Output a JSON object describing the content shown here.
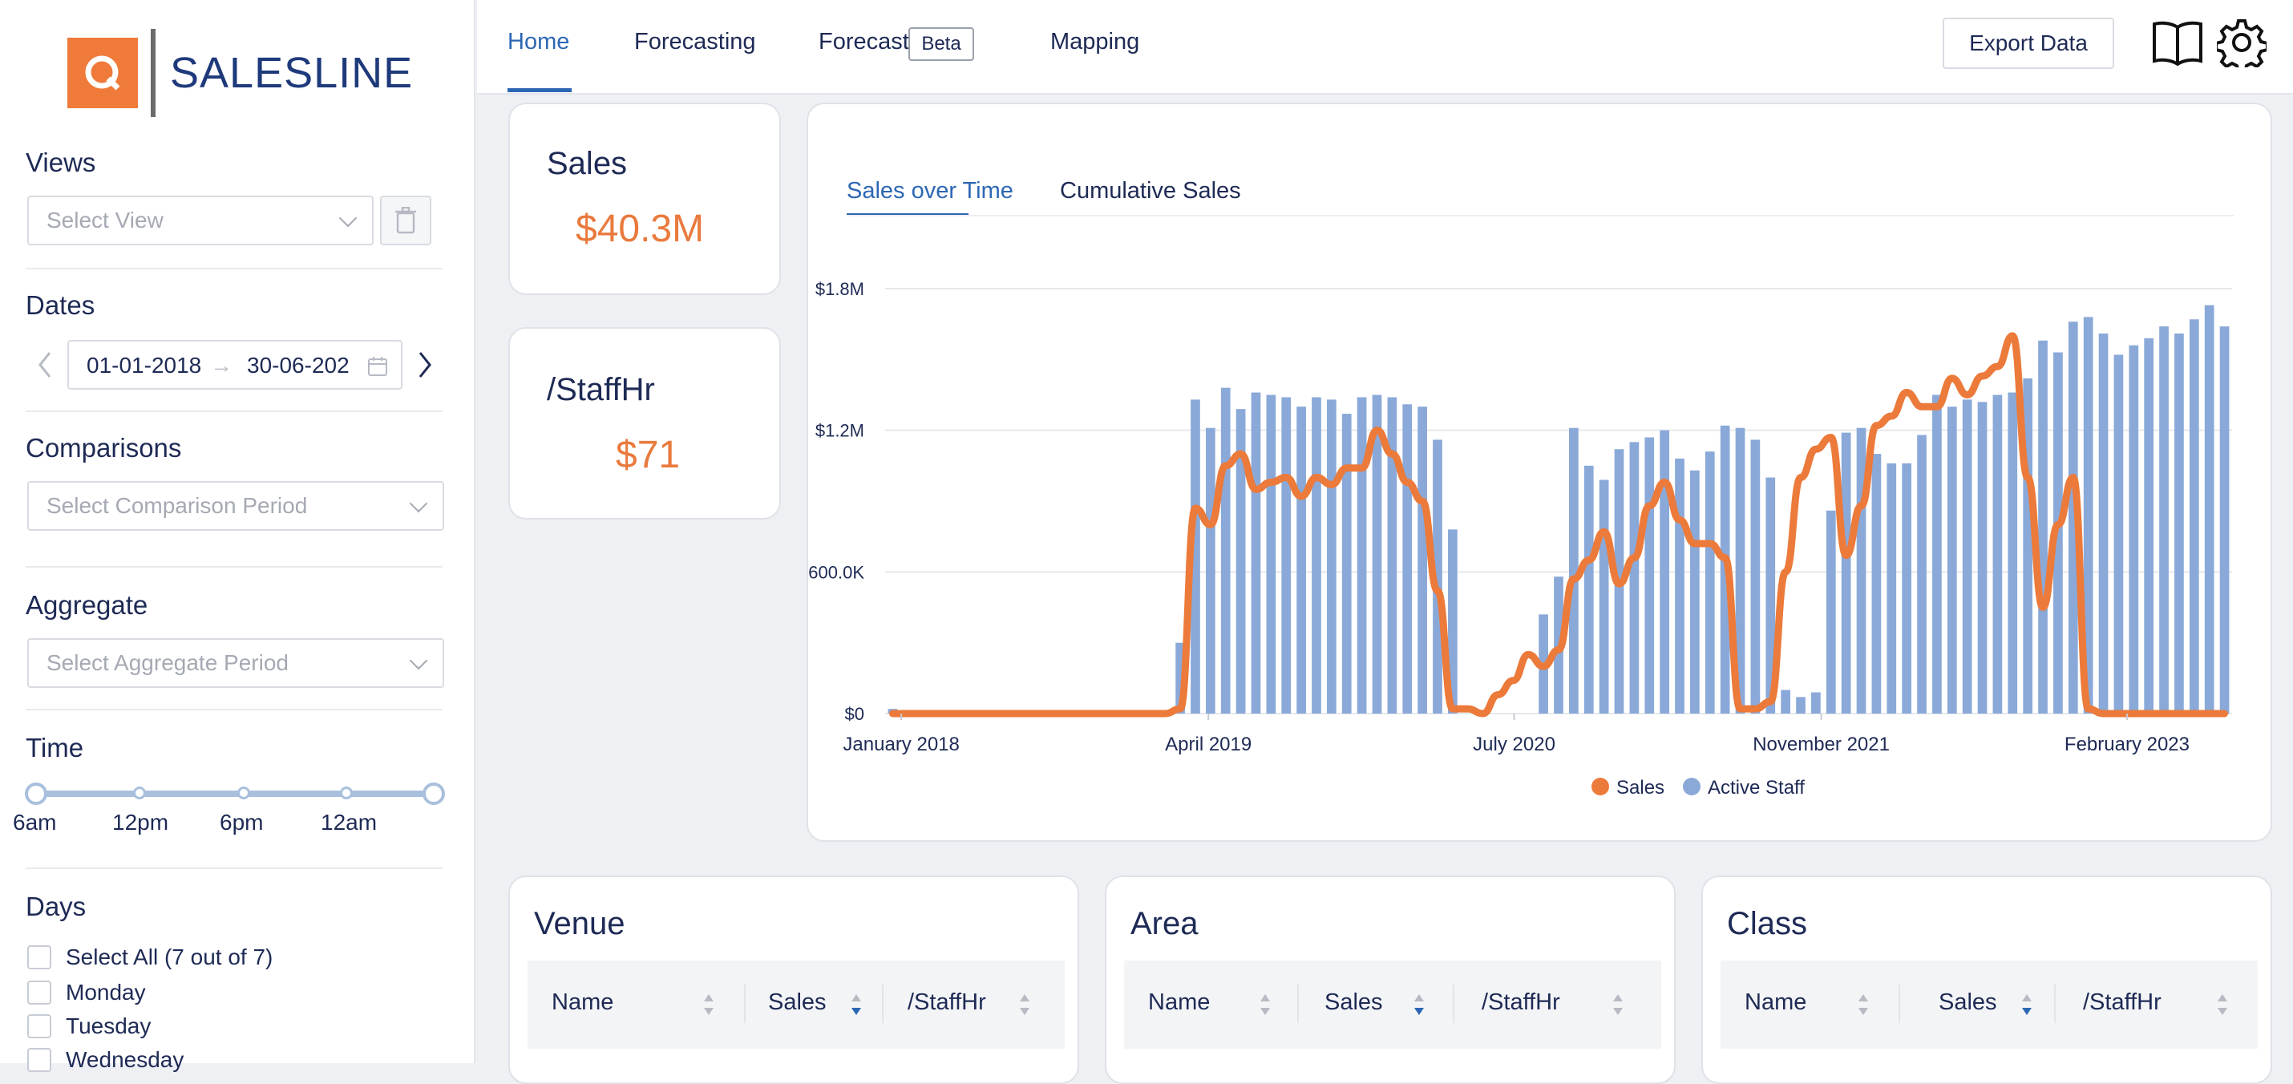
{
  "brand": {
    "name": "SALESLINE",
    "logo_letter": "Q",
    "accent": "#ef7a39",
    "primary": "#2d67b3"
  },
  "nav": {
    "tabs": [
      {
        "label": "Home",
        "active": true
      },
      {
        "label": "Forecasting"
      },
      {
        "label": "Forecast",
        "badge": "Beta"
      },
      {
        "label": "Mapping"
      }
    ],
    "export_label": "Export Data",
    "icons": [
      "book-icon",
      "gear-icon"
    ]
  },
  "sidebar": {
    "views": {
      "label": "Views",
      "placeholder": "Select View"
    },
    "dates": {
      "label": "Dates",
      "start": "01-01-2018",
      "end": "30-06-202"
    },
    "comparisons": {
      "label": "Comparisons",
      "placeholder": "Select Comparison Period"
    },
    "aggregate": {
      "label": "Aggregate",
      "placeholder": "Select Aggregate Period"
    },
    "time": {
      "label": "Time",
      "ticks": [
        "6am",
        "12pm",
        "6pm",
        "12am"
      ]
    },
    "days": {
      "label": "Days",
      "options": [
        "Select All (7 out of 7)",
        "Monday",
        "Tuesday",
        "Wednesday"
      ]
    }
  },
  "kpis": {
    "sales": {
      "title": "Sales",
      "value": "$40.3M"
    },
    "staffhr": {
      "title": "/StaffHr",
      "value": "$71"
    }
  },
  "chart_tabs": [
    {
      "label": "Sales over Time",
      "active": true
    },
    {
      "label": "Cumulative Sales"
    }
  ],
  "chart_data": {
    "type": "bar",
    "ylim": [
      0,
      1800000
    ],
    "yticks": [
      "$0",
      "$600.0K",
      "$1.2M",
      "$1.8M"
    ],
    "xticks": [
      "January 2018",
      "April 2019",
      "July 2020",
      "November 2021",
      "February 2023"
    ],
    "colors": {
      "sales": "#ec7a3a",
      "staff": "#8aa9d8"
    },
    "series": [
      {
        "name": "Active Staff",
        "type": "bar",
        "values": [
          0.02,
          0,
          0,
          0,
          0,
          0,
          0,
          0,
          0,
          0,
          0,
          0,
          0,
          0,
          0,
          0,
          0,
          0,
          0,
          0.3,
          1.33,
          1.21,
          1.38,
          1.29,
          1.36,
          1.35,
          1.34,
          1.3,
          1.34,
          1.33,
          1.27,
          1.34,
          1.35,
          1.34,
          1.31,
          1.3,
          1.16,
          0.78,
          0,
          0,
          0,
          0,
          0,
          0.42,
          0.58,
          1.21,
          1.05,
          0.99,
          1.12,
          1.15,
          1.17,
          1.2,
          1.08,
          1.03,
          1.11,
          1.22,
          1.21,
          1.16,
          1.0,
          0.1,
          0.07,
          0.09,
          0.86,
          1.19,
          1.21,
          1.1,
          1.06,
          1.06,
          1.18,
          1.35,
          1.3,
          1.33,
          1.32,
          1.35,
          1.36,
          1.42,
          1.58,
          1.53,
          1.66,
          1.68,
          1.61,
          1.52,
          1.56,
          1.59,
          1.64,
          1.61,
          1.67,
          1.73,
          1.64
        ]
      },
      {
        "name": "Sales",
        "type": "line",
        "values": [
          0,
          0,
          0,
          0,
          0,
          0,
          0,
          0,
          0,
          0,
          0,
          0,
          0,
          0,
          0,
          0,
          0,
          0,
          0,
          0.02,
          0.87,
          0.8,
          1.05,
          1.1,
          0.95,
          0.98,
          1.0,
          0.92,
          1.0,
          0.97,
          1.04,
          1.04,
          1.2,
          1.1,
          0.98,
          0.9,
          0.52,
          0.02,
          0.02,
          0.0,
          0.08,
          0.14,
          0.25,
          0.2,
          0.27,
          0.57,
          0.65,
          0.77,
          0.55,
          0.66,
          0.88,
          0.98,
          0.82,
          0.72,
          0.72,
          0.66,
          0.02,
          0.02,
          0.05,
          0.6,
          1.0,
          1.12,
          1.17,
          0.67,
          0.88,
          1.22,
          1.26,
          1.36,
          1.3,
          1.3,
          1.42,
          1.35,
          1.43,
          1.47,
          1.6,
          1.0,
          0.45,
          0.8,
          1.0,
          0.02,
          0.0,
          0.0,
          0.0,
          0.0,
          0.0,
          0.0,
          0.0,
          0.0,
          0.0
        ],
        "scale": 1200000
      }
    ],
    "legend": [
      "Sales",
      "Active Staff"
    ],
    "legend_position": "bottom"
  },
  "tables": [
    {
      "title": "Venue",
      "columns": [
        "Name",
        "Sales",
        "/StaffHr"
      ]
    },
    {
      "title": "Area",
      "columns": [
        "Name",
        "Sales",
        "/StaffHr"
      ]
    },
    {
      "title": "Class",
      "columns": [
        "Name",
        "Sales",
        "/StaffHr"
      ]
    }
  ]
}
